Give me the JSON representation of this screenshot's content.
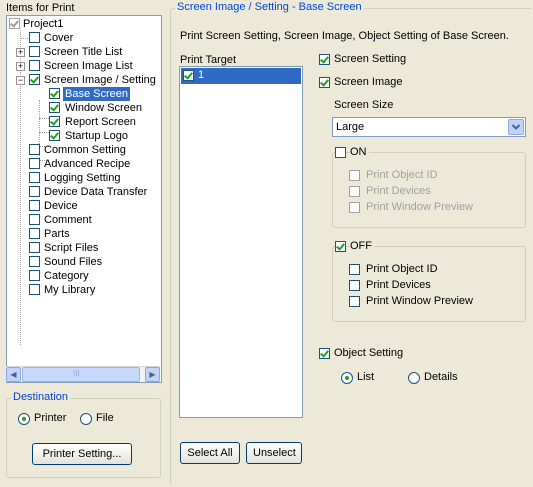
{
  "left": {
    "title": "Items for Print",
    "tree": [
      {
        "label": "Project1"
      },
      {
        "label": "Cover"
      },
      {
        "label": "Screen Title List"
      },
      {
        "label": "Screen Image List"
      },
      {
        "label": "Screen Image / Setting"
      },
      {
        "label": "Base Screen"
      },
      {
        "label": "Window Screen"
      },
      {
        "label": "Report Screen"
      },
      {
        "label": "Startup Logo"
      },
      {
        "label": "Common Setting"
      },
      {
        "label": "Advanced Recipe"
      },
      {
        "label": "Logging Setting"
      },
      {
        "label": "Device Data Transfer"
      },
      {
        "label": "Device"
      },
      {
        "label": "Comment"
      },
      {
        "label": "Parts"
      },
      {
        "label": "Script Files"
      },
      {
        "label": "Sound Files"
      },
      {
        "label": "Category"
      },
      {
        "label": "My Library"
      }
    ],
    "scroll_thumb_glyph": "III"
  },
  "destination": {
    "title": "Destination",
    "printer": "Printer",
    "file": "File",
    "printer_setting": "Printer Setting..."
  },
  "right": {
    "title": "Screen Image / Setting - Base Screen",
    "description": "Print Screen Setting, Screen Image, Object Setting of Base Screen.",
    "print_target_label": "Print Target",
    "targets": [
      "1"
    ],
    "select_all": "Select All",
    "unselect": "Unselect",
    "screen_setting": "Screen Setting",
    "screen_image": "Screen Image",
    "screen_size_label": "Screen Size",
    "screen_size_value": "Large",
    "on_group": {
      "title": "ON",
      "print_object_id": "Print Object ID",
      "print_devices": "Print Devices",
      "print_window_preview": "Print Window Preview"
    },
    "off_group": {
      "title": "OFF",
      "print_object_id": "Print Object ID",
      "print_devices": "Print Devices",
      "print_window_preview": "Print Window Preview"
    },
    "object_setting": "Object Setting",
    "list": "List",
    "details": "Details"
  }
}
